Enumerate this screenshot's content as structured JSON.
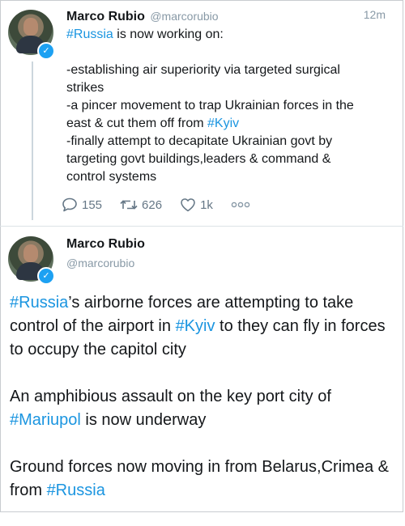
{
  "tweet1": {
    "name": "Marco Rubio",
    "handle": "@marcorubio",
    "time": "12m",
    "lines": [
      {
        "tag": "#Russia",
        "text": " is now working on:"
      },
      {
        "text": ""
      },
      {
        "text": "-establishing air superiority via targeted surgical"
      },
      {
        "text": "strikes"
      },
      {
        "text": "-a pincer movement to trap Ukrainian forces in the"
      },
      {
        "text": "east & cut them off from ",
        "tag": "#Kyiv"
      },
      {
        "text": "-finally attempt to decapitate Ukrainian govt by"
      },
      {
        "text": "targeting govt buildings,leaders & command &"
      },
      {
        "text": "control systems"
      }
    ],
    "actions": {
      "reply_count": "155",
      "retweet_count": "626",
      "like_count": "1k",
      "reply_icon": "reply-icon",
      "retweet_icon": "retweet-icon",
      "like_icon": "heart-icon",
      "more_icon": "more-icon"
    }
  },
  "tweet2": {
    "name": "Marco Rubio",
    "handle": "@marcorubio",
    "p1": {
      "tag1": "#Russia",
      "t1": "’s airborne forces are attempting to take control of the airport in ",
      "tag2": "#Kyiv",
      "t2": " to they can fly in forces to occupy the capitol city"
    },
    "p2": {
      "t1": "An amphibious assault on the key port city of ",
      "tag": "#Mariupol",
      "t2": " is now underway"
    },
    "p3": {
      "t1": "Ground forces now moving in from Belarus,Crimea & from ",
      "tag": "#Russia"
    }
  },
  "colors": {
    "link": "#1b95e0",
    "verified": "#1da1f2",
    "muted": "#657786"
  }
}
